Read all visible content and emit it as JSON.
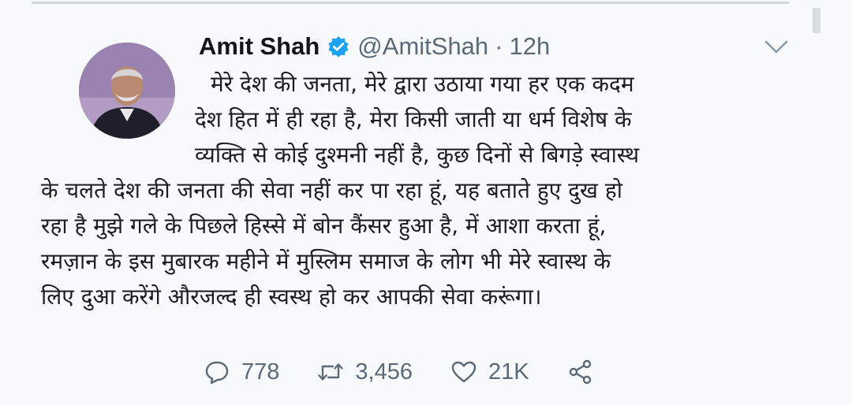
{
  "tweet": {
    "author_name": "Amit Shah",
    "handle": "@AmitShah",
    "separator": "·",
    "time": "12h",
    "verified": true,
    "text_lines": [
      "मेरे देश की जनता, मेरे द्वारा उठाया गया हर एक कदम",
      "देश हित में ही रहा है, मेरा किसी जाती या धर्म विशेष के",
      "व्यक्ति से कोई दुश्मनी नहीं है, कुछ दिनों से बिगड़े स्वास्थ",
      "के चलते देश की जनता की सेवा नहीं कर पा रहा हूं, यह बताते हुए दुख हो",
      "रहा है मुझे गले के पिछले हिस्से में बोन कैंसर हुआ है, में आशा करता हूं,",
      "रमज़ान के इस मुबारक महीने में मुस्लिम समाज के लोग भी मेरे स्वास्थ के",
      "लिए दुआ करेंगे औरजल्द ही स्वस्थ हो कर आपकी सेवा करूंगा।"
    ]
  },
  "actions": {
    "reply_count": "778",
    "retweet_count": "3,456",
    "like_count": "21K"
  },
  "icons": {
    "verified": "verified-badge-icon",
    "menu": "chevron-down-icon",
    "reply": "reply-icon",
    "retweet": "retweet-icon",
    "like": "heart-icon",
    "share": "share-icon"
  },
  "colors": {
    "verified_blue": "#1da1f2",
    "secondary_text": "#5b6a78",
    "background": "#f7f9fa"
  }
}
